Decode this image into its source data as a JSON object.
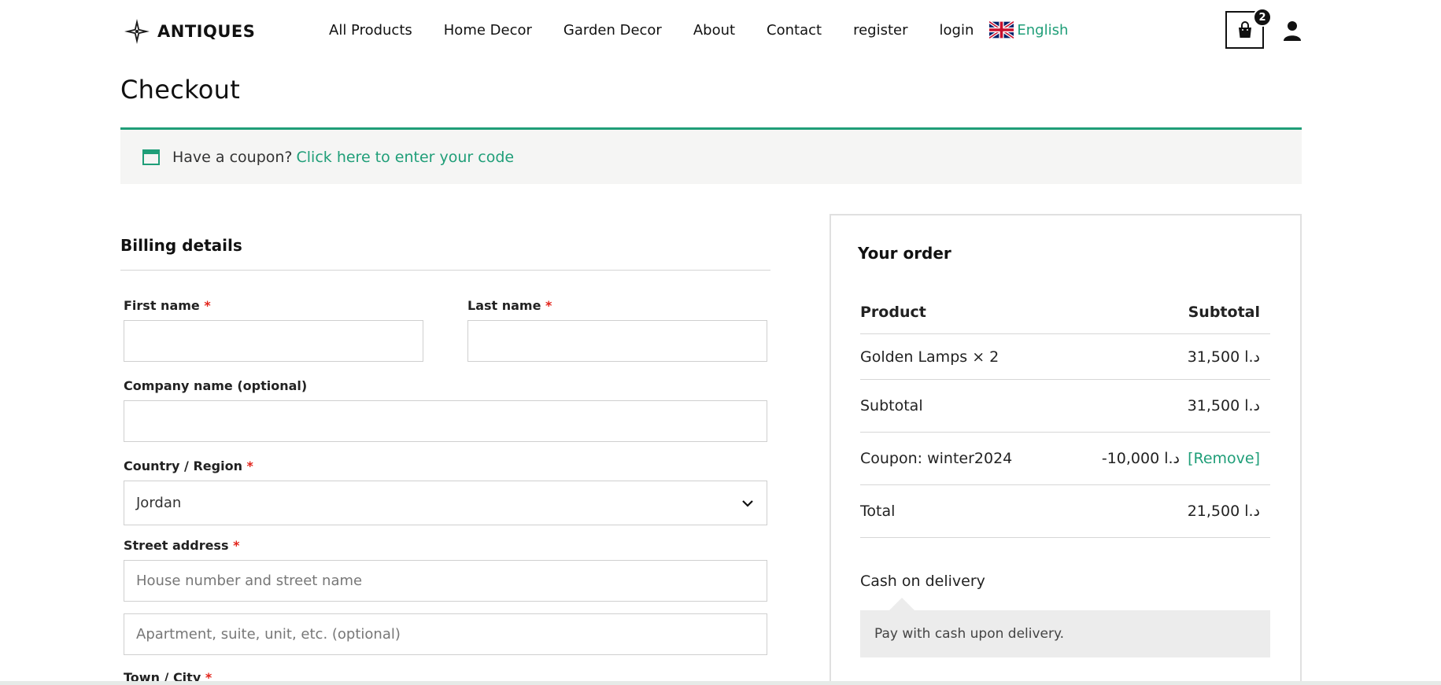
{
  "header": {
    "logo_text": "ANTIQUES",
    "nav": [
      "All Products",
      "Home Decor",
      "Garden Decor",
      "About",
      "Contact",
      "register",
      "login"
    ],
    "language": "English",
    "cart_count": "2"
  },
  "page": {
    "title": "Checkout"
  },
  "coupon": {
    "prompt": "Have a coupon?",
    "link": "Click here to enter your code"
  },
  "billing": {
    "title": "Billing details",
    "first_name_label": "First name",
    "last_name_label": "Last name",
    "company_label": "Company name (optional)",
    "country_label": "Country / Region",
    "country_value": "Jordan",
    "street_label": "Street address",
    "street_placeholder": "House number and street name",
    "apartment_placeholder": "Apartment, suite, unit, etc. (optional)",
    "city_label": "Town / City",
    "required_mark": "*"
  },
  "order": {
    "title": "Your order",
    "col_product": "Product",
    "col_subtotal": "Subtotal",
    "item_name": "Golden Lamps × 2",
    "item_total": "31,500 د.ا",
    "subtotal_label": "Subtotal",
    "subtotal_value": "31,500 د.ا",
    "coupon_label": "Coupon: winter2024",
    "coupon_value": "-10,000 د.ا",
    "coupon_remove": "[Remove]",
    "total_label": "Total",
    "total_value": "21,500 د.ا",
    "payment_method": "Cash on delivery",
    "payment_note": "Pay with cash upon delivery."
  },
  "colors": {
    "accent": "#1f9e78",
    "required": "#e2231a"
  }
}
